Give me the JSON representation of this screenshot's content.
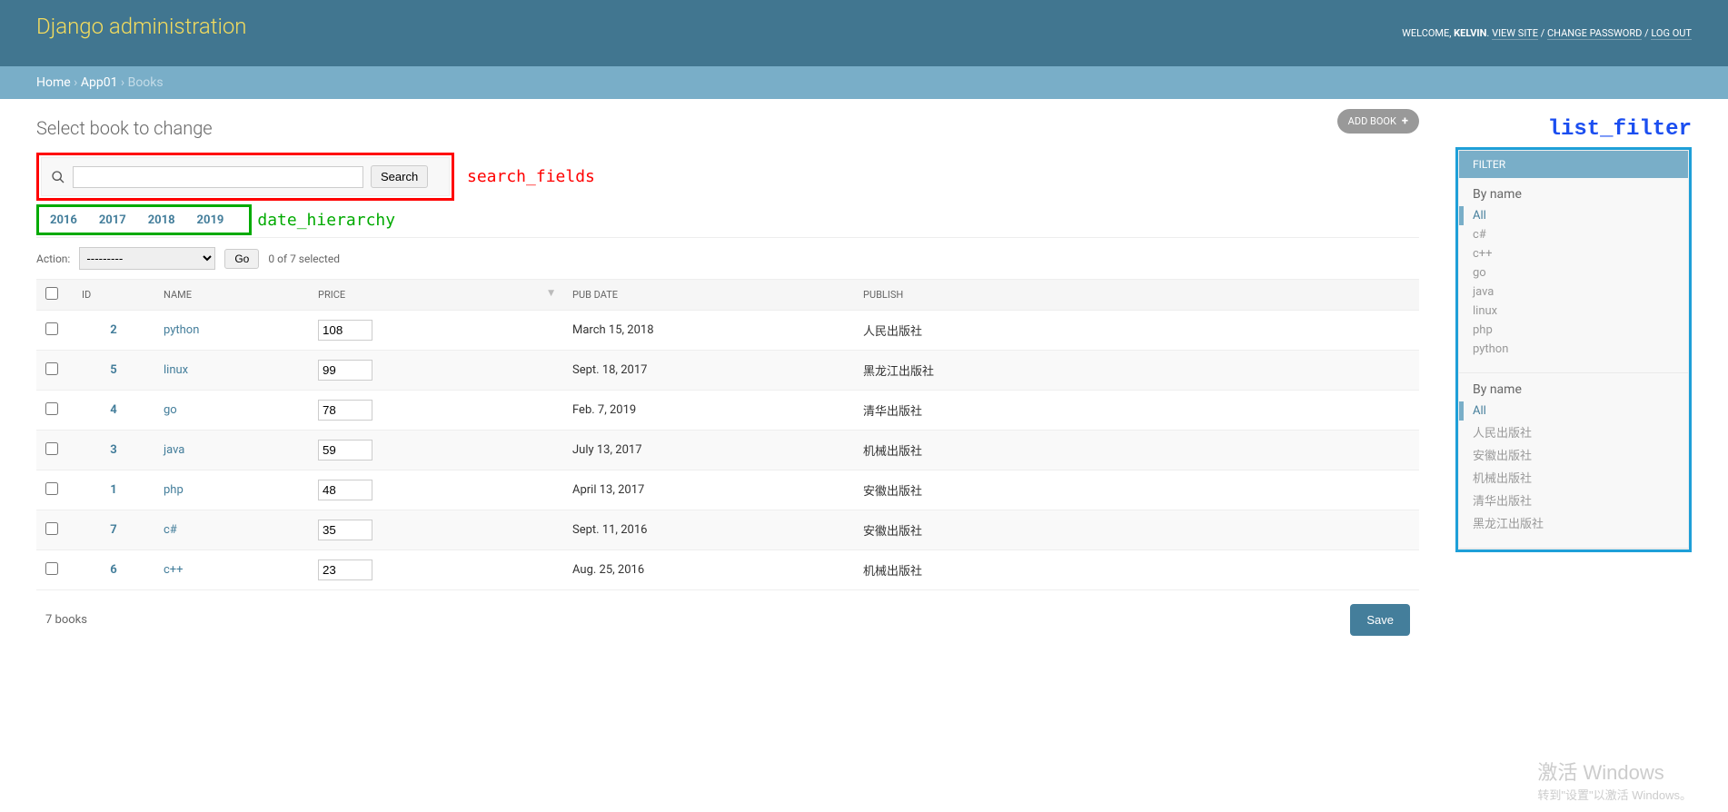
{
  "header": {
    "title": "Django administration",
    "welcome": "WELCOME, ",
    "user": "KELVIN",
    "dot": ". ",
    "view_site": "VIEW SITE",
    "sep": " / ",
    "change_password": "CHANGE PASSWORD",
    "log_out": "LOG OUT"
  },
  "breadcrumbs": {
    "home": "Home",
    "app": "App01",
    "current": "Books",
    "sep": " › "
  },
  "page": {
    "title": "Select book to change",
    "add_button": "ADD BOOK",
    "search_button": "Search",
    "action_label": "Action:",
    "action_placeholder": "---------",
    "go_button": "Go",
    "selection_text": "0 of 7 selected",
    "count_text": "7 books",
    "save_button": "Save"
  },
  "annotations": {
    "search_fields": "search_fields",
    "date_hierarchy": "date_hierarchy",
    "list_filter": "list_filter"
  },
  "date_hierarchy": [
    "2016",
    "2017",
    "2018",
    "2019"
  ],
  "columns": {
    "id": "ID",
    "name": "NAME",
    "price": "PRICE",
    "pub_date": "PUB DATE",
    "publish": "PUBLISH"
  },
  "rows": [
    {
      "id": "2",
      "name": "python",
      "price": "108",
      "pub_date": "March 15, 2018",
      "publish": "人民出版社"
    },
    {
      "id": "5",
      "name": "linux",
      "price": "99",
      "pub_date": "Sept. 18, 2017",
      "publish": "黑龙江出版社"
    },
    {
      "id": "4",
      "name": "go",
      "price": "78",
      "pub_date": "Feb. 7, 2019",
      "publish": "清华出版社"
    },
    {
      "id": "3",
      "name": "java",
      "price": "59",
      "pub_date": "July 13, 2017",
      "publish": "机械出版社"
    },
    {
      "id": "1",
      "name": "php",
      "price": "48",
      "pub_date": "April 13, 2017",
      "publish": "安徽出版社"
    },
    {
      "id": "7",
      "name": "c#",
      "price": "35",
      "pub_date": "Sept. 11, 2016",
      "publish": "安徽出版社"
    },
    {
      "id": "6",
      "name": "c++",
      "price": "23",
      "pub_date": "Aug. 25, 2016",
      "publish": "机械出版社"
    }
  ],
  "filter": {
    "title": "FILTER",
    "groups": [
      {
        "heading": "By name",
        "items": [
          "All",
          "c#",
          "c++",
          "go",
          "java",
          "linux",
          "php",
          "python"
        ],
        "selected": 0
      },
      {
        "heading": "By name",
        "items": [
          "All",
          "人民出版社",
          "安徽出版社",
          "机械出版社",
          "清华出版社",
          "黑龙江出版社"
        ],
        "selected": 0
      }
    ]
  },
  "watermark": {
    "line1": "激活 Windows",
    "line2": "转到\"设置\"以激活 Windows。"
  }
}
